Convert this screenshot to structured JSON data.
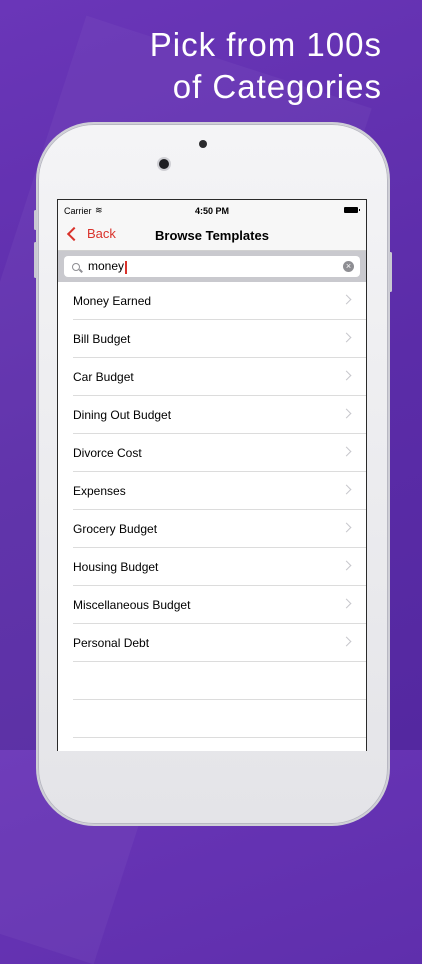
{
  "headline": {
    "line1": "Pick from 100s",
    "line2": "of Categories"
  },
  "status_bar": {
    "carrier": "Carrier",
    "time": "4:50 PM"
  },
  "nav": {
    "back_label": "Back",
    "title": "Browse Templates"
  },
  "search": {
    "value": "money"
  },
  "templates": [
    "Money Earned",
    "Bill Budget",
    "Car Budget",
    "Dining Out Budget",
    "Divorce Cost",
    "Expenses",
    "Grocery Budget",
    "Housing Budget",
    "Miscellaneous Budget",
    "Personal Debt"
  ],
  "colors": {
    "accent": "#d9322b",
    "background": "#5b2ca8"
  }
}
